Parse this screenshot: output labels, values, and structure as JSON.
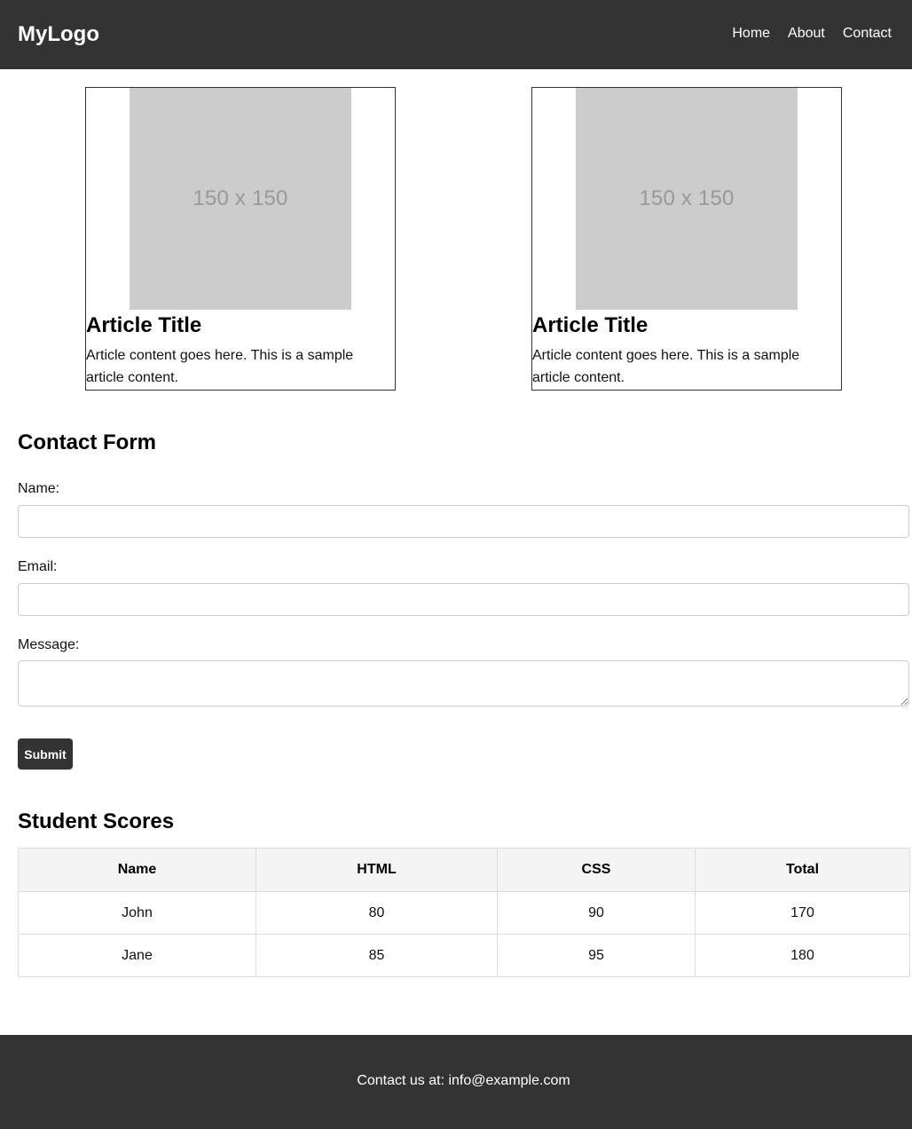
{
  "header": {
    "logo": "MyLogo",
    "nav": [
      {
        "label": "Home"
      },
      {
        "label": "About"
      },
      {
        "label": "Contact"
      }
    ]
  },
  "articles": [
    {
      "image_text": "150 x 150",
      "title": "Article Title",
      "body": "Article content goes here. This is a sample article content."
    },
    {
      "image_text": "150 x 150",
      "title": "Article Title",
      "body": "Article content goes here. This is a sample article content."
    }
  ],
  "contact_form": {
    "title": "Contact Form",
    "name_label": "Name:",
    "name_value": "",
    "email_label": "Email:",
    "email_value": "",
    "message_label": "Message:",
    "message_value": "",
    "submit_label": "Submit"
  },
  "scores": {
    "title": "Student Scores",
    "columns": [
      "Name",
      "HTML",
      "CSS",
      "Total"
    ],
    "rows": [
      [
        "John",
        "80",
        "90",
        "170"
      ],
      [
        "Jane",
        "85",
        "95",
        "180"
      ]
    ]
  },
  "footer": {
    "text": "Contact us at: info@example.com"
  },
  "colors": {
    "header_bg": "#333333",
    "footer_bg": "#333333",
    "placeholder_bg": "#cccccc",
    "table_header_bg": "#f4f4f4"
  }
}
